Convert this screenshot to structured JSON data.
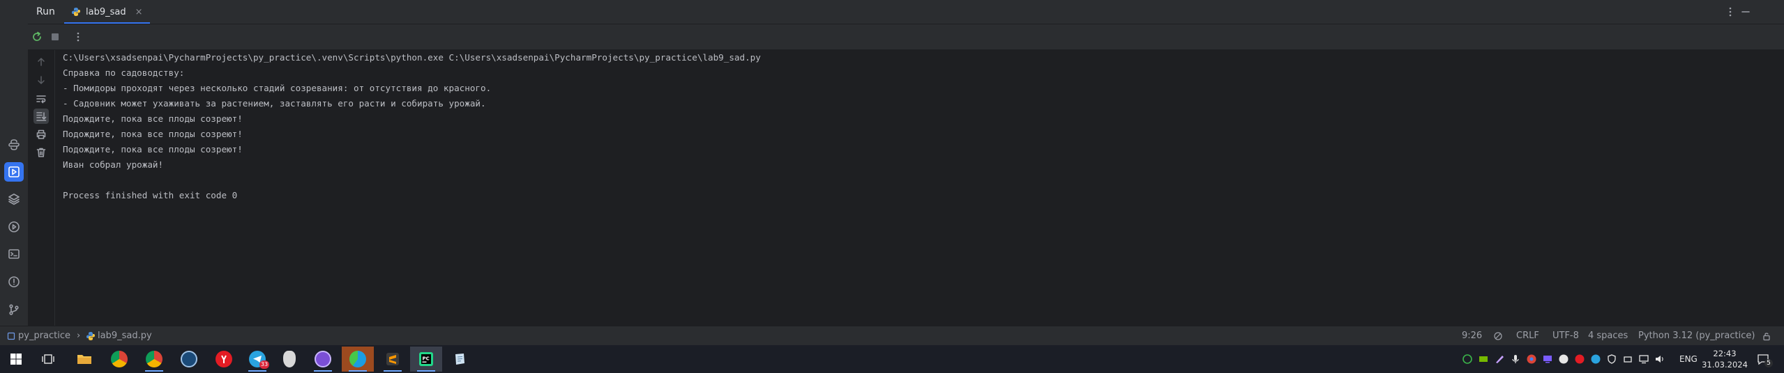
{
  "tabbar": {
    "run_title": "Run",
    "tab_label": "lab9_sad",
    "tab_close": "×"
  },
  "console": {
    "lines": [
      "C:\\Users\\xsadsenpai\\PycharmProjects\\py_practice\\.venv\\Scripts\\python.exe C:\\Users\\xsadsenpai\\PycharmProjects\\py_practice\\lab9_sad.py",
      "Справка по садоводству:",
      "- Помидоры проходят через несколько стадий созревания: от отсутствия до красного.",
      "- Садовник может ухаживать за растением, заставлять его расти и собирать урожай.",
      "Подождите, пока все плоды созреют!",
      "Подождите, пока все плоды созреют!",
      "Подождите, пока все плоды созреют!",
      "Иван собрал урожай!",
      "",
      "Process finished with exit code 0"
    ]
  },
  "statusbar": {
    "project": "py_practice",
    "separator": "›",
    "file": "lab9_sad.py",
    "position": "9:26",
    "line_ending": "CRLF",
    "encoding": "UTF-8",
    "indent": "4 spaces",
    "interpreter": "Python 3.12 (py_practice)"
  },
  "taskbar": {
    "telegram_badge": "33",
    "language": "ENG",
    "time": "22:43",
    "date": "31.03.2024",
    "notifications_count": "5"
  },
  "colors": {
    "accent": "#3574f0",
    "panel": "#2b2d30",
    "editor_bg": "#1e1f22",
    "text": "#bcbec4"
  }
}
